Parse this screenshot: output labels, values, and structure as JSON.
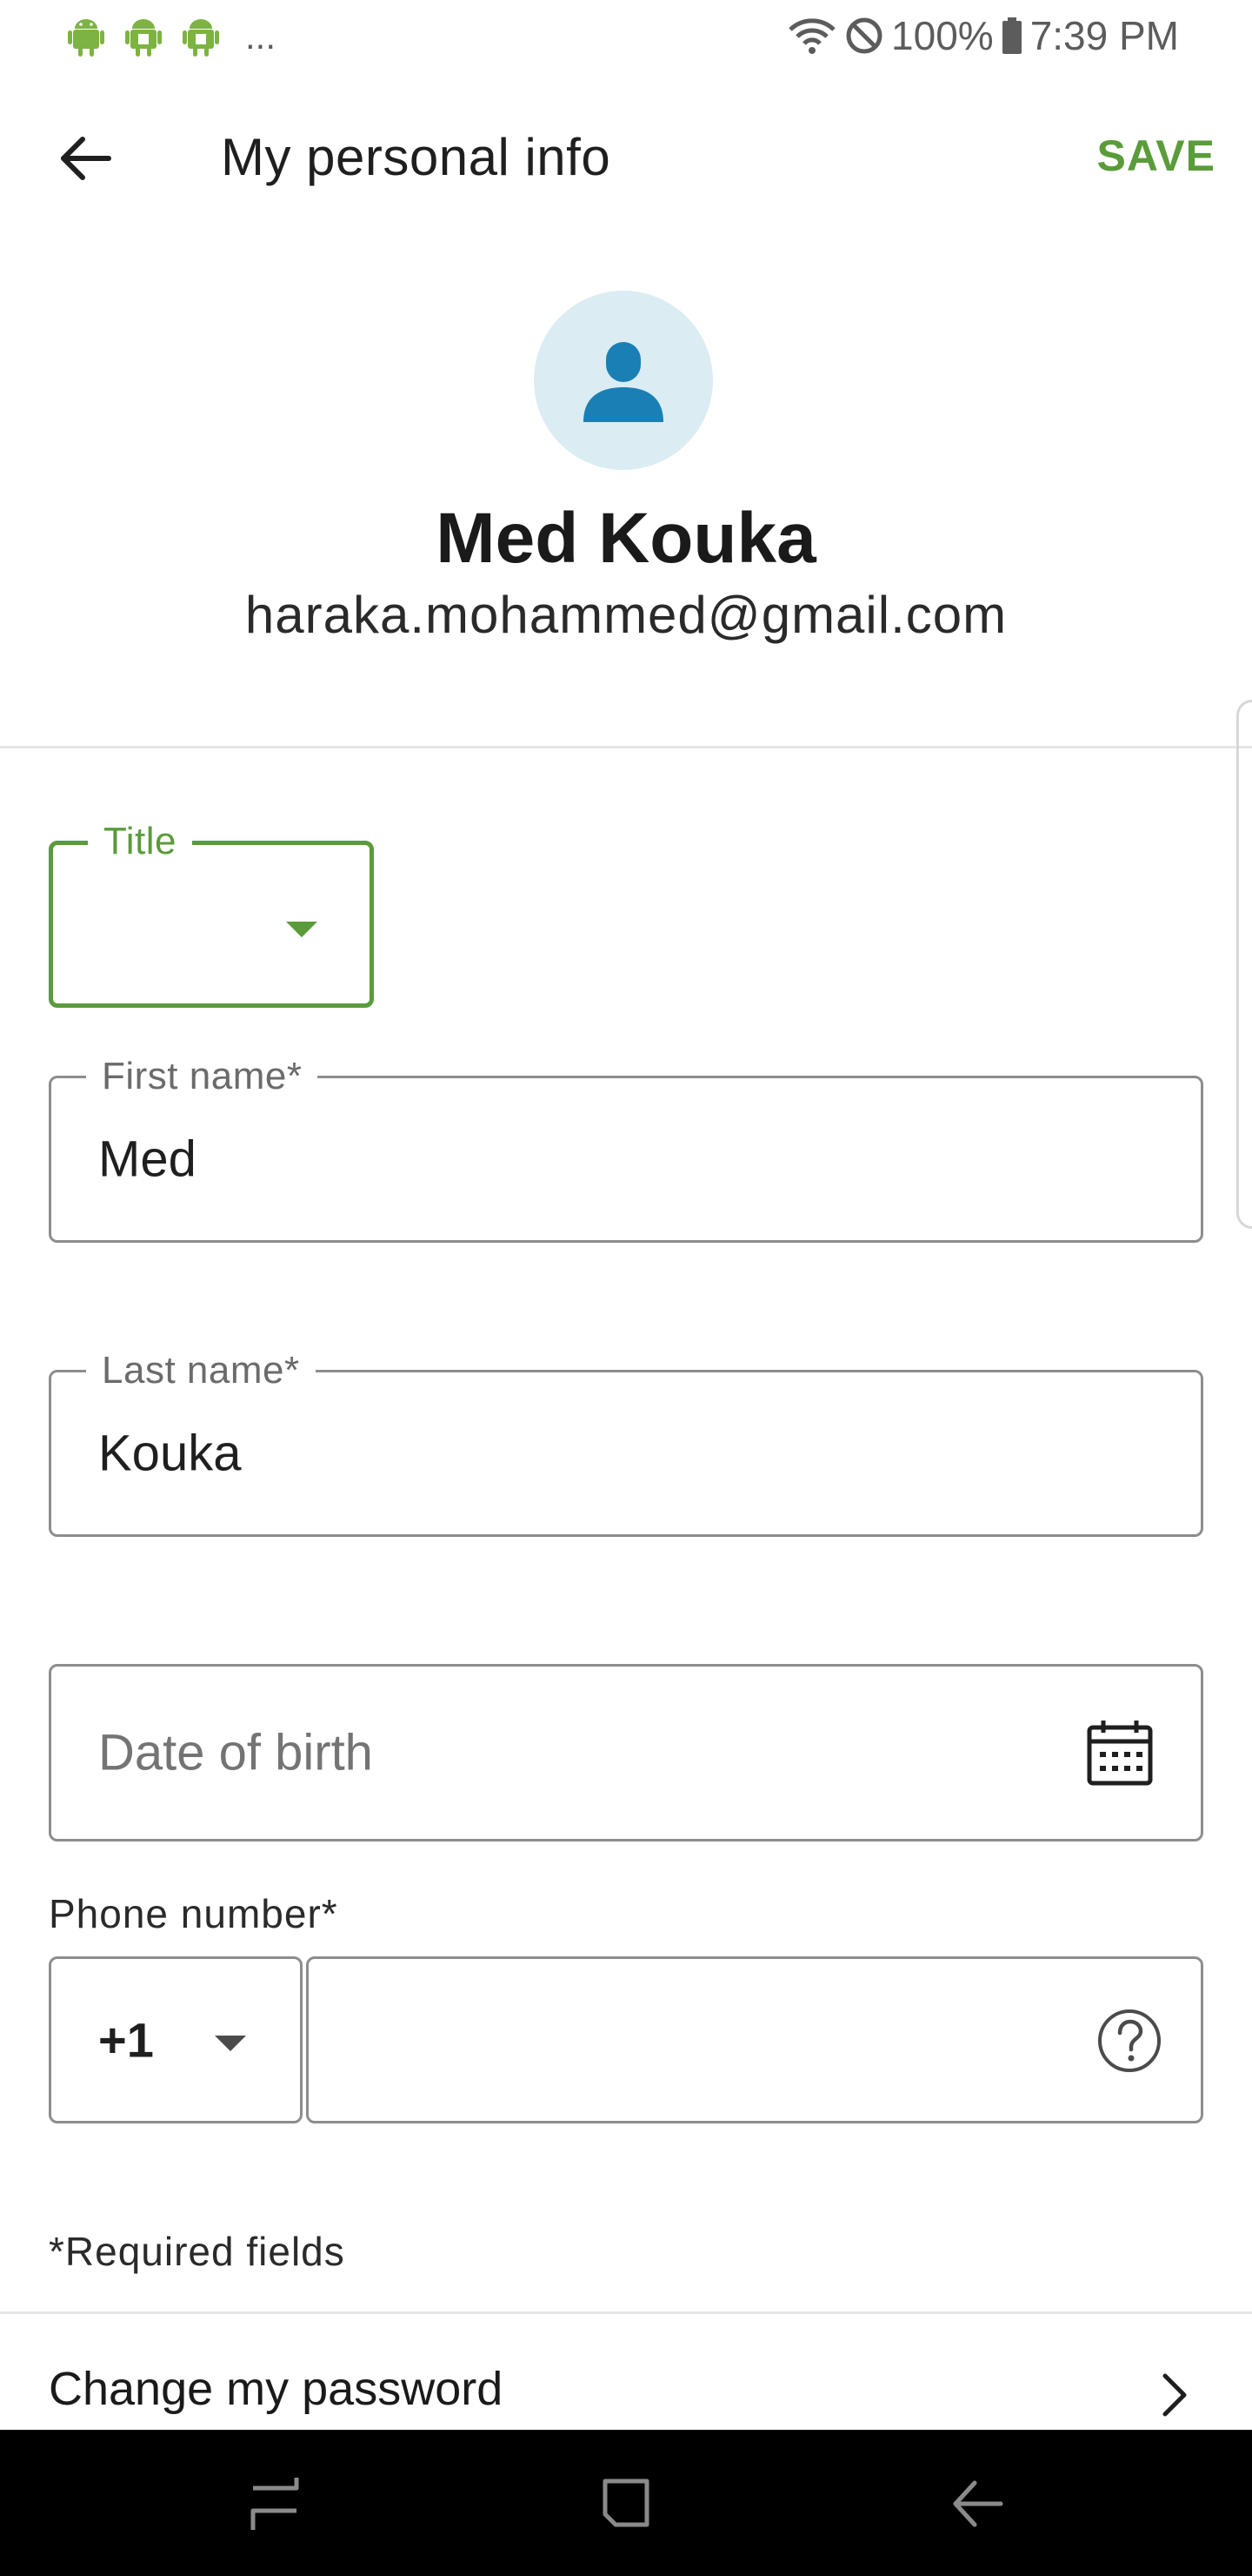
{
  "status_bar": {
    "notification_overflow": "...",
    "battery_percent": "100%",
    "time": "7:39 PM"
  },
  "app_bar": {
    "title": "My personal info",
    "save_label": "SAVE"
  },
  "profile": {
    "name": "Med Kouka",
    "email": "haraka.mohammed@gmail.com"
  },
  "form": {
    "title_label": "Title",
    "title_value": "",
    "first_name_label": "First name*",
    "first_name_value": "Med",
    "last_name_label": "Last name*",
    "last_name_value": "Kouka",
    "dob_placeholder": "Date of birth",
    "phone_label": "Phone number*",
    "country_code": "+1",
    "phone_value": "",
    "required_note": "*Required fields"
  },
  "links": {
    "change_password": "Change my password"
  },
  "colors": {
    "accent": "#5a9b3a",
    "avatar_bg": "#dbecf3",
    "avatar_icon": "#1a7fb5"
  }
}
